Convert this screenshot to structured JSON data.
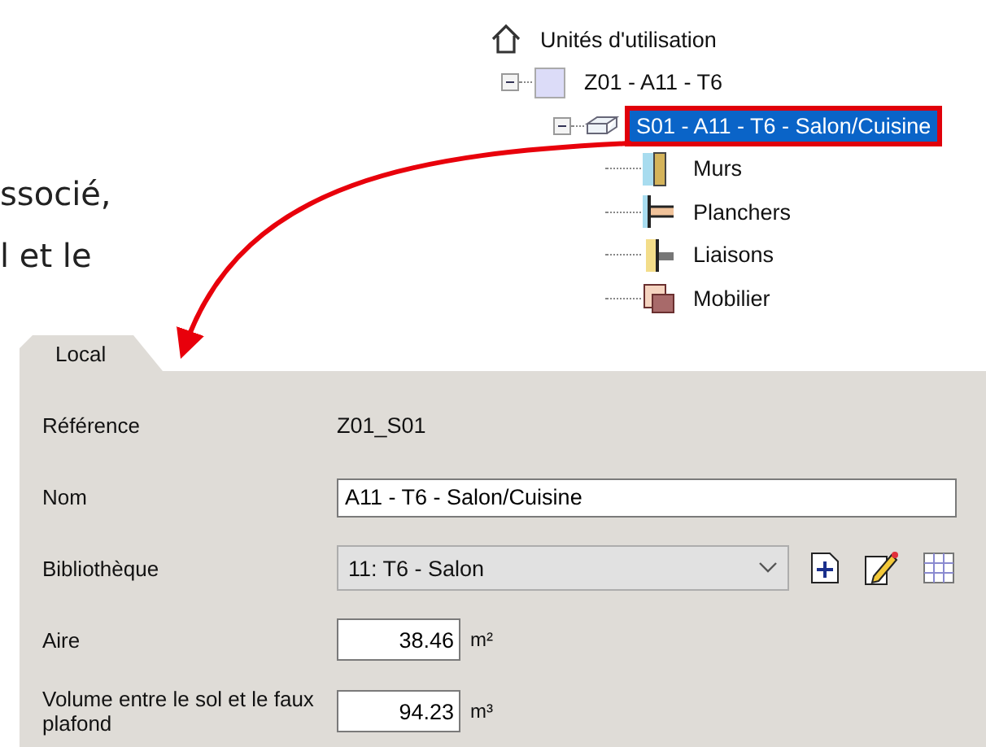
{
  "intro_text": [
    "ssocié,",
    "l et le"
  ],
  "tree": [
    {
      "label": "Unités d'utilisation",
      "kind": "house",
      "selected": false,
      "children": [
        {
          "label": "Z01 - A11 - T6",
          "kind": "zone",
          "selected": false,
          "expanded": true,
          "children": [
            {
              "label": "S01 - A11 - T6 - Salon/Cuisine",
              "kind": "room",
              "selected": true,
              "expanded": true,
              "children": [
                {
                  "label": "Murs",
                  "kind": "wall",
                  "selected": false
                },
                {
                  "label": "Planchers",
                  "kind": "floor",
                  "selected": false
                },
                {
                  "label": "Liaisons",
                  "kind": "junction",
                  "selected": false
                },
                {
                  "label": "Mobilier",
                  "kind": "furniture",
                  "selected": false
                }
              ]
            }
          ]
        }
      ]
    }
  ],
  "tabs": [
    {
      "label": "Local",
      "selected": true
    }
  ],
  "fields": [
    {
      "kind": "static",
      "label": "Référence",
      "value": "Z01_S01"
    },
    {
      "kind": "text",
      "label": "Nom",
      "value": "A11 - T6 - Salon/Cuisine"
    },
    {
      "kind": "select",
      "label": "Bibliothèque",
      "value": "11: T6 - Salon"
    },
    {
      "kind": "number",
      "label": "Aire",
      "value": "38.46",
      "unit": "m²"
    },
    {
      "kind": "number",
      "label": "Volume entre le sol et le faux plafond",
      "value": "94.23",
      "unit": "m³"
    }
  ]
}
